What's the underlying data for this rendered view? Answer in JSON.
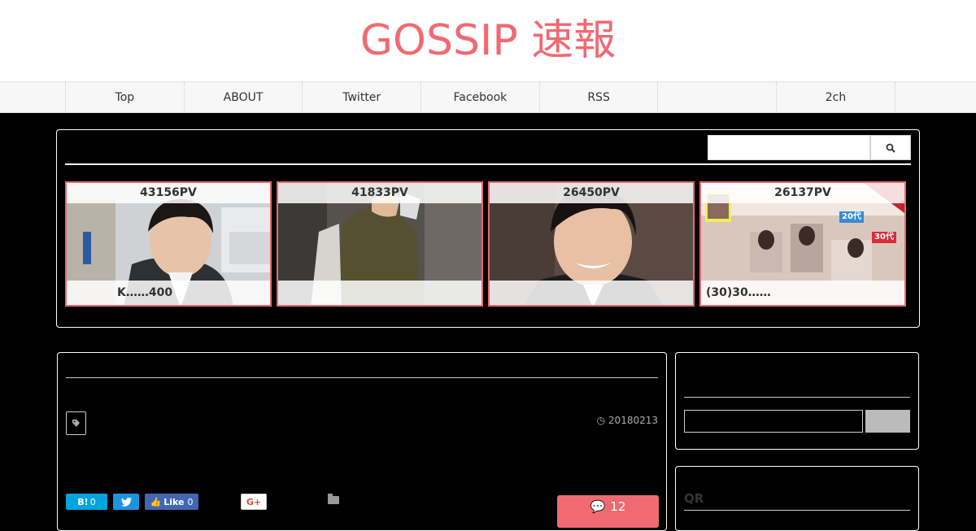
{
  "header": {
    "title": "GOSSIP 速報"
  },
  "nav": {
    "items": [
      "Top",
      "ABOUT",
      "Twitter",
      "Facebook",
      "RSS",
      "",
      "2ch"
    ]
  },
  "ranking": {
    "cards": [
      {
        "pv": "43156PV",
        "caption": "K……400"
      },
      {
        "pv": "41833PV",
        "caption": ""
      },
      {
        "pv": "26450PV",
        "caption": ""
      },
      {
        "pv": "26137PV",
        "caption": "(30)30……",
        "badges": [
          "20代",
          "30代"
        ]
      }
    ]
  },
  "article": {
    "date": "20180213",
    "share": {
      "hatena_label": "B!",
      "hatena_count": "0",
      "fb_label": "Like",
      "fb_count": "0",
      "gplus_label": "G+"
    },
    "comments_count": "12"
  },
  "sidebar": {
    "qr_title": "QR"
  },
  "colors": {
    "accent": "#f06a72",
    "card_border": "#e56a72"
  }
}
